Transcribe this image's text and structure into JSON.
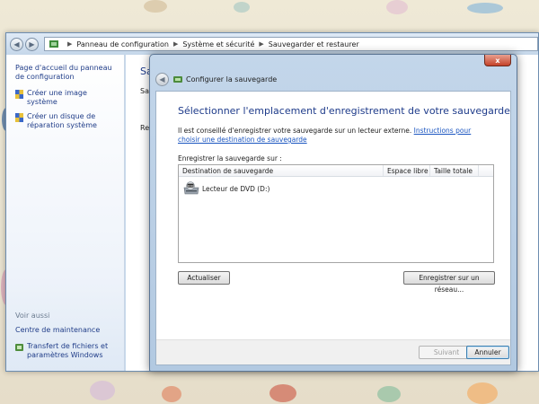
{
  "breadcrumb": {
    "items": [
      "Panneau de configuration",
      "Système et sécurité",
      "Sauvegarder et restaurer"
    ]
  },
  "left_pane": {
    "home_link": "Page d'accueil du panneau de configuration",
    "tasks": [
      "Créer une image système",
      "Créer un disque de réparation système"
    ],
    "see_also_heading": "Voir aussi",
    "see_also": [
      "Centre de maintenance",
      "Transfert de fichiers et paramètres Windows"
    ]
  },
  "main_pane": {
    "title_partial": "Sa",
    "sub_partial": "Sau",
    "restore_partial": "Res"
  },
  "dialog": {
    "close_label": "x",
    "caption": "Configurer la sauvegarde",
    "heading": "Sélectionner l'emplacement d'enregistrement de votre sauvegarde",
    "description": "Il est conseillé d'enregistrer votre sauvegarde sur un lecteur externe.",
    "help_link": "Instructions pour choisir une destination de sauvegarde",
    "save_on_label": "Enregistrer la sauvegarde sur :",
    "columns": [
      "Destination de sauvegarde",
      "Espace libre",
      "Taille totale"
    ],
    "rows": [
      {
        "name": "Lecteur de DVD (D:)",
        "free": "",
        "total": ""
      }
    ],
    "refresh_button": "Actualiser",
    "network_button": "Enregistrer sur un réseau...",
    "next_button": "Suivant",
    "cancel_button": "Annuler"
  },
  "colors": {
    "link": "#1a55c0",
    "heading": "#1e3b8a",
    "close": "#c4422a"
  }
}
